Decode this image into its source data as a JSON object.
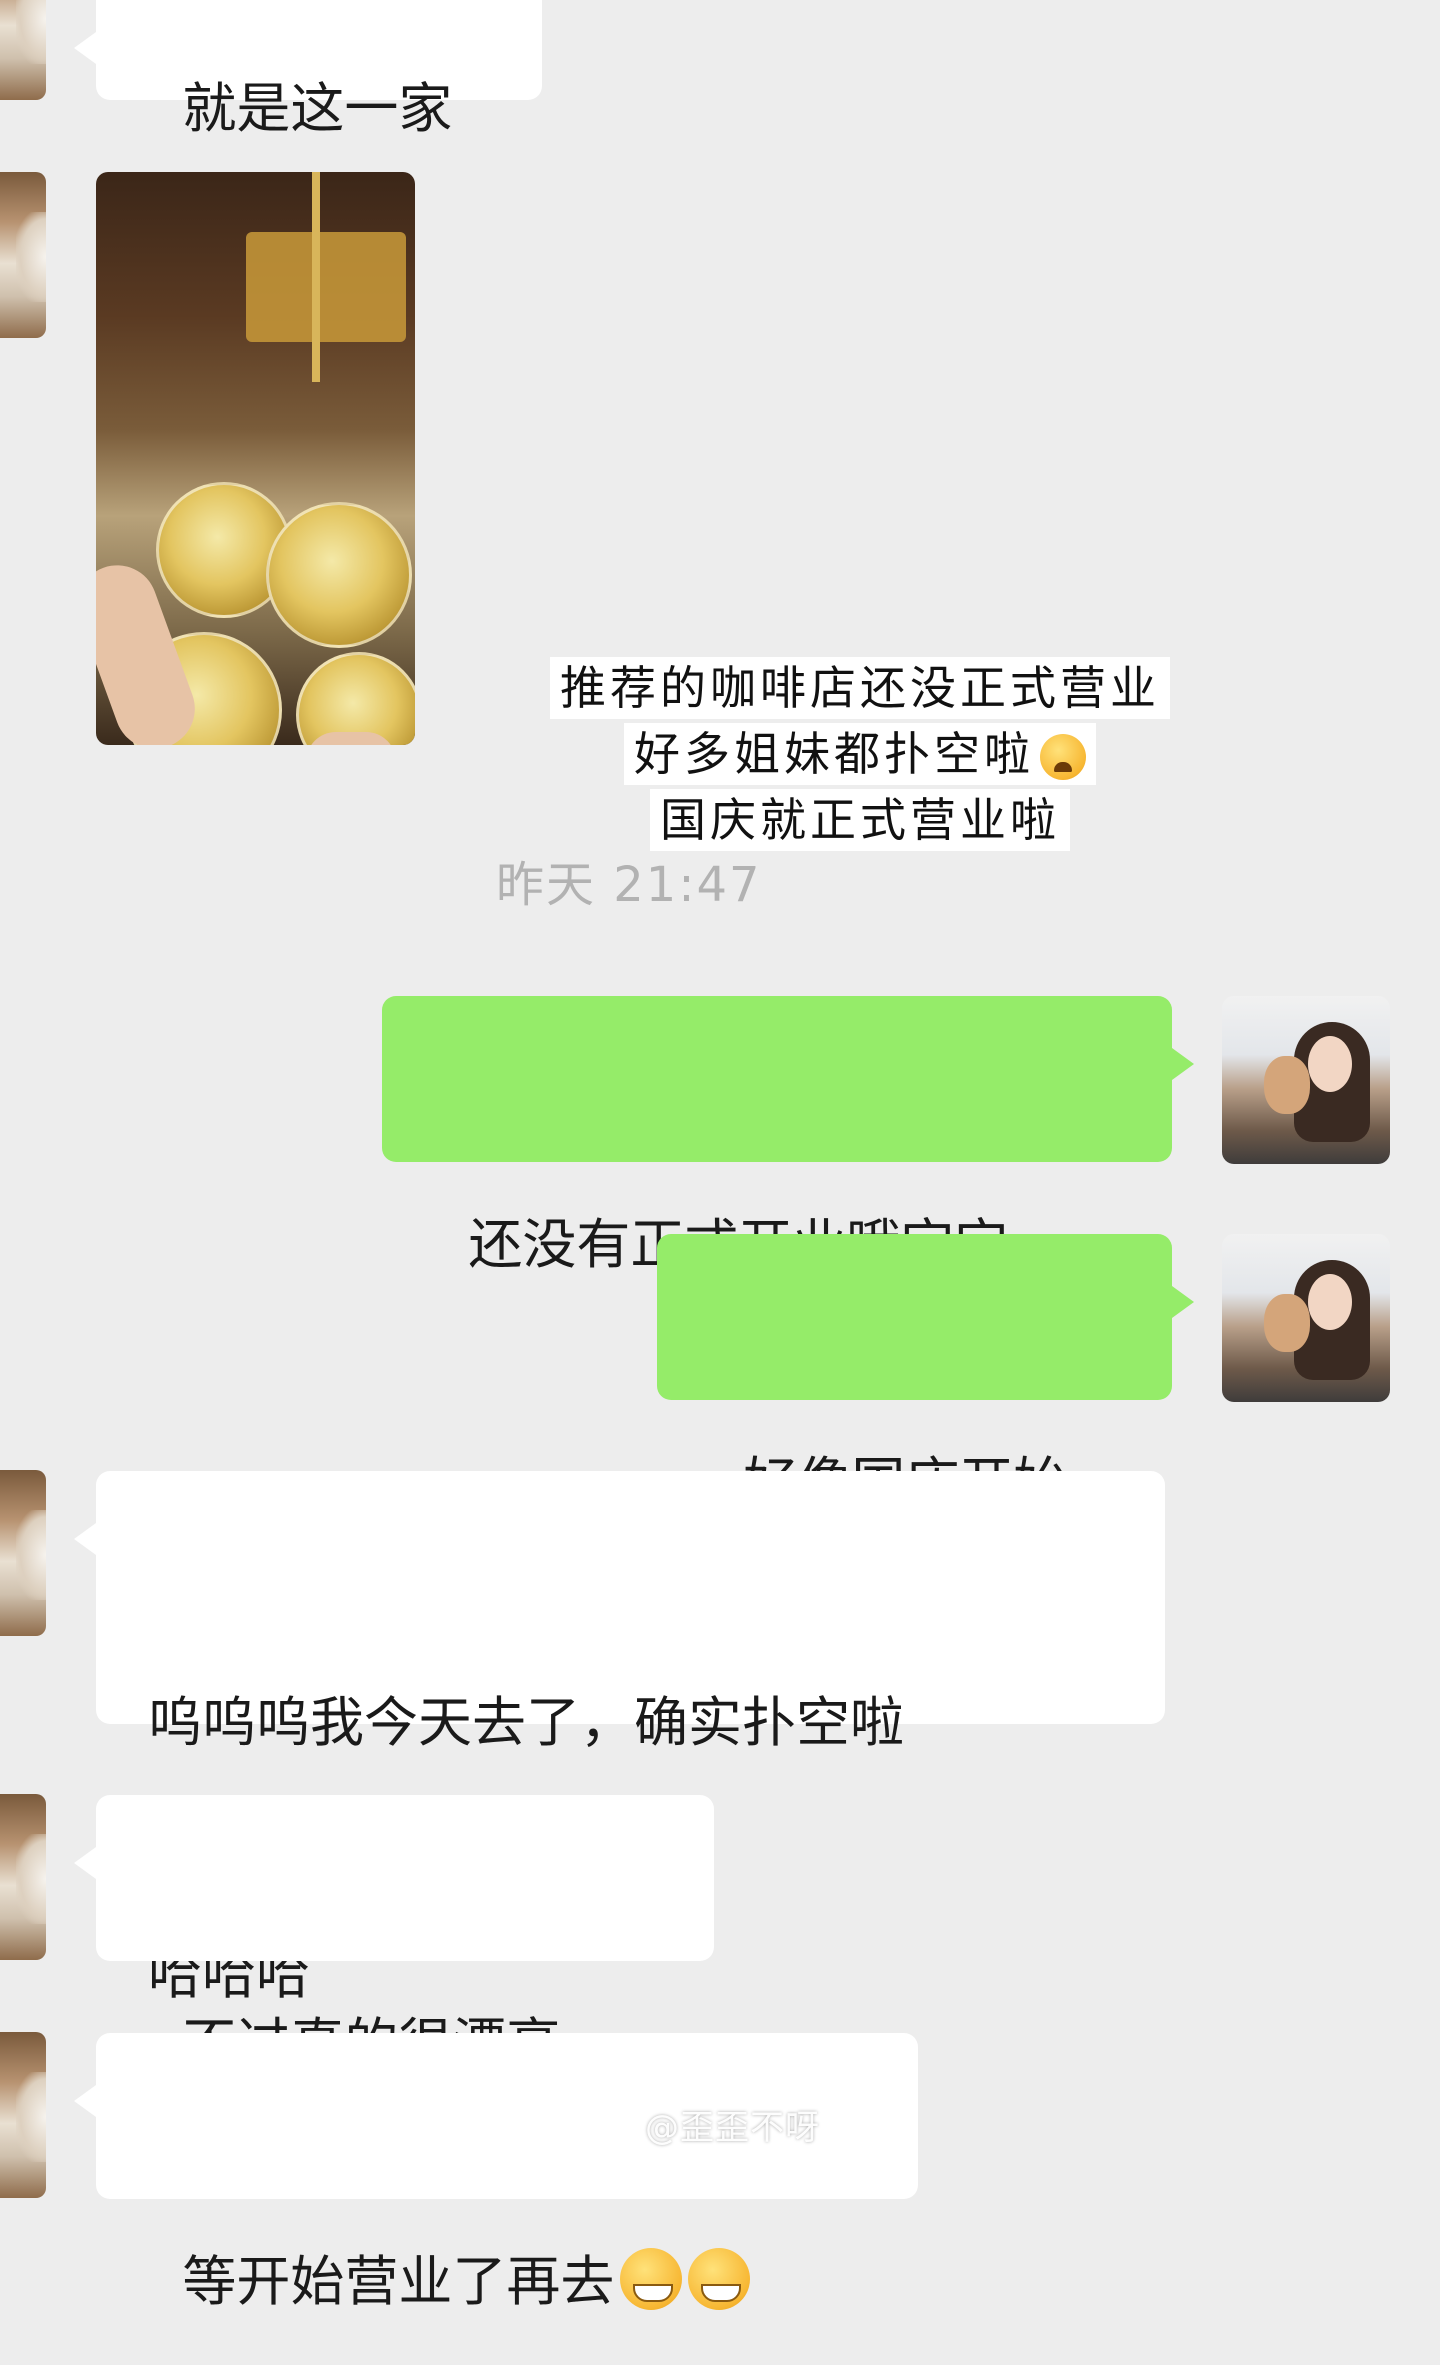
{
  "messages": {
    "m1": "就是这一家",
    "m2": "还没有正式开业哦宝宝",
    "m3": "好像国庆开始",
    "m4_line1": "呜呜呜我今天去了，确实扑空啦",
    "m4_line2": "哈哈哈",
    "m5": "不过真的很漂亮，",
    "m6": "等开始营业了再去"
  },
  "image_caption": {
    "line1": "推荐的咖啡店还没正式营业",
    "line2": "好多姐妹都扑空啦",
    "line3": "国庆就正式营业啦"
  },
  "timestamp": "昨天 21:47",
  "watermark": "@歪歪不呀",
  "icons": {
    "cry_emoji": "loudly-crying-face",
    "grin_emoji": "grinning-face"
  }
}
